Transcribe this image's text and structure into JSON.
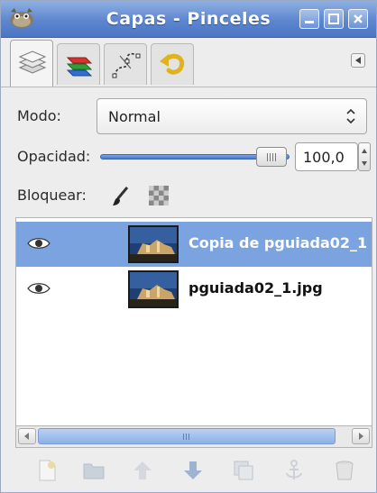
{
  "window": {
    "title": "Capas - Pinceles"
  },
  "title_buttons": [
    "minimize",
    "maximize",
    "close"
  ],
  "tabs": [
    {
      "name": "layers-tab",
      "icon": "layers-icon"
    },
    {
      "name": "channels-tab",
      "icon": "channels-icon"
    },
    {
      "name": "paths-tab",
      "icon": "paths-icon"
    },
    {
      "name": "undo-history-tab",
      "icon": "undo-icon"
    }
  ],
  "mode": {
    "label": "Modo:",
    "value": "Normal"
  },
  "opacity": {
    "label": "Opacidad:",
    "value": "100,0",
    "fraction": 1.0
  },
  "lock": {
    "label": "Bloquear:"
  },
  "layers": [
    {
      "name": "Copia de pguiada02_1",
      "visible": true,
      "selected": true
    },
    {
      "name": "pguiada02_1.jpg",
      "visible": true,
      "selected": false
    }
  ],
  "colors": {
    "selection": "#7ba3e0",
    "titlebar": "#5d86cf"
  }
}
